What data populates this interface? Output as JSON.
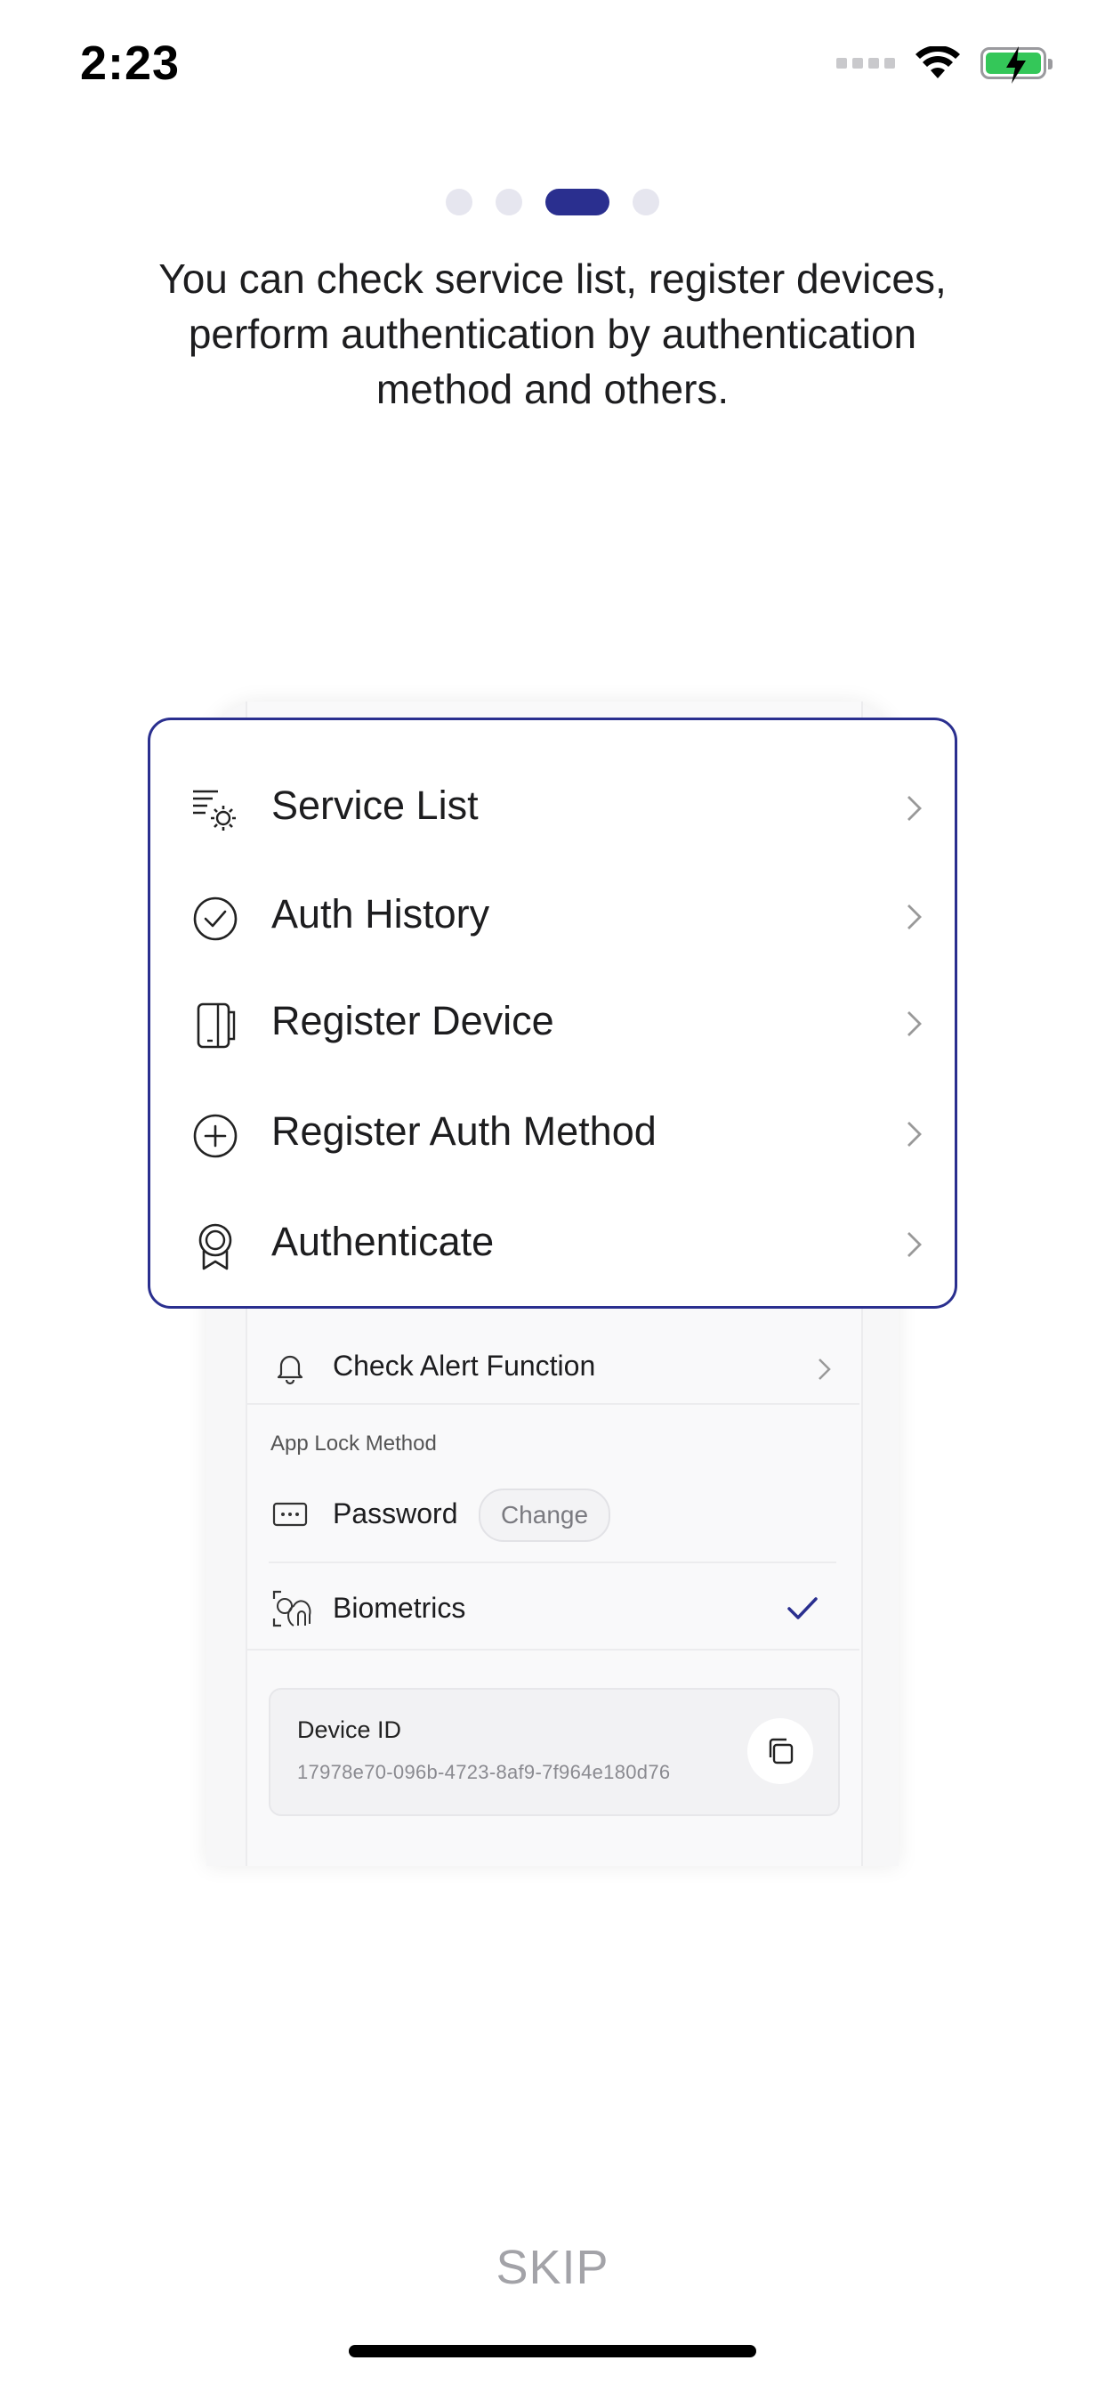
{
  "status_bar": {
    "time": "2:23",
    "wifi_icon": "wifi-icon",
    "battery_icon": "battery-charging-icon"
  },
  "pager": {
    "total": 4,
    "active_index": 2
  },
  "headline": "You can check service list, register devices, perform authentication by authentication method and others.",
  "menu": {
    "items": [
      {
        "label": "Service List",
        "icon": "service-list-icon"
      },
      {
        "label": "Auth History",
        "icon": "check-circle-icon"
      },
      {
        "label": "Register Device",
        "icon": "device-icon"
      },
      {
        "label": "Register Auth Method",
        "icon": "plus-circle-icon"
      },
      {
        "label": "Authenticate",
        "icon": "award-icon"
      }
    ]
  },
  "background_screen": {
    "alert_row": {
      "label": "Check Alert Function",
      "icon": "bell-icon"
    },
    "section_label": "App Lock Method",
    "password_row": {
      "label": "Password",
      "icon": "password-icon",
      "action": "Change"
    },
    "biometrics_row": {
      "label": "Biometrics",
      "icon": "fingerprint-face-icon",
      "selected": true
    },
    "device_card": {
      "title": "Device ID",
      "value": "17978e70-096b-4723-8af9-7f964e180d76",
      "icon": "copy-icon"
    }
  },
  "footer": {
    "skip_label": "SKIP"
  },
  "colors": {
    "accent": "#2a2f8f",
    "battery": "#34c759",
    "muted": "#a3a3a8"
  }
}
